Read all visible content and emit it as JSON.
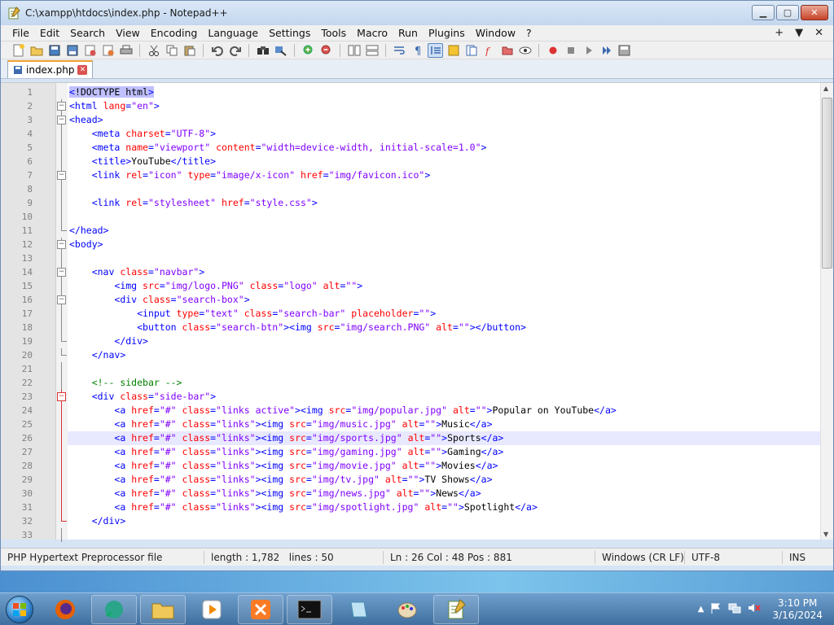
{
  "window": {
    "title": "C:\\xampp\\htdocs\\index.php - Notepad++",
    "controls": {
      "minimize": "▁",
      "maximize": "▢",
      "close": "✕"
    }
  },
  "menu": {
    "items": [
      "File",
      "Edit",
      "Search",
      "View",
      "Encoding",
      "Language",
      "Settings",
      "Tools",
      "Macro",
      "Run",
      "Plugins",
      "Window",
      "?"
    ],
    "right": [
      "+",
      "▼",
      "✕"
    ]
  },
  "tabs": [
    {
      "label": "index.php",
      "active": true
    }
  ],
  "editor": {
    "current_line": 26,
    "lines": [
      {
        "n": "1",
        "fold": "",
        "html": "<span class='t-sel'><span class='t-tag'>&lt;</span>!DOCTYPE html<span class='t-tag'>&gt;</span></span>"
      },
      {
        "n": "2",
        "fold": "box",
        "html": "<span class='t-tag'>&lt;html</span> <span class='t-attr'>lang</span><span class='t-tag'>=</span><span class='t-val'>\"en\"</span><span class='t-tag'>&gt;</span>"
      },
      {
        "n": "3",
        "fold": "box",
        "html": "<span class='t-tag'>&lt;head&gt;</span>"
      },
      {
        "n": "4",
        "fold": "bar",
        "html": "    <span class='t-tag'>&lt;meta</span> <span class='t-attr'>charset</span><span class='t-tag'>=</span><span class='t-val'>\"UTF-8\"</span><span class='t-tag'>&gt;</span>"
      },
      {
        "n": "5",
        "fold": "bar",
        "html": "    <span class='t-tag'>&lt;meta</span> <span class='t-attr'>name</span><span class='t-tag'>=</span><span class='t-val'>\"viewport\"</span> <span class='t-attr'>content</span><span class='t-tag'>=</span><span class='t-val'>\"width=device-width, initial-scale=1.0\"</span><span class='t-tag'>&gt;</span>"
      },
      {
        "n": "6",
        "fold": "bar",
        "html": "    <span class='t-tag'>&lt;title&gt;</span><span class='t-txt'>YouTube</span><span class='t-tag'>&lt;/title&gt;</span>"
      },
      {
        "n": "7",
        "fold": "box",
        "html": "    <span class='t-tag'>&lt;link</span> <span class='t-attr'>rel</span><span class='t-tag'>=</span><span class='t-val'>\"icon\"</span> <span class='t-attr'>type</span><span class='t-tag'>=</span><span class='t-val'>\"image/x-icon\"</span> <span class='t-attr'>href</span><span class='t-tag'>=</span><span class='t-val'>\"img/favicon.ico\"</span><span class='t-tag'>&gt;</span>"
      },
      {
        "n": "8",
        "fold": "bar",
        "html": ""
      },
      {
        "n": "9",
        "fold": "bar",
        "html": "    <span class='t-tag'>&lt;link</span> <span class='t-attr'>rel</span><span class='t-tag'>=</span><span class='t-val'>\"stylesheet\"</span> <span class='t-attr'>href</span><span class='t-tag'>=</span><span class='t-val'>\"style.css\"</span><span class='t-tag'>&gt;</span>"
      },
      {
        "n": "10",
        "fold": "bar",
        "html": ""
      },
      {
        "n": "11",
        "fold": "end",
        "html": "<span class='t-tag'>&lt;/head&gt;</span>"
      },
      {
        "n": "12",
        "fold": "box",
        "html": "<span class='t-tag'>&lt;body&gt;</span>"
      },
      {
        "n": "13",
        "fold": "bar",
        "html": ""
      },
      {
        "n": "14",
        "fold": "box",
        "html": "    <span class='t-tag'>&lt;nav</span> <span class='t-attr'>class</span><span class='t-tag'>=</span><span class='t-val'>\"navbar\"</span><span class='t-tag'>&gt;</span>"
      },
      {
        "n": "15",
        "fold": "bar",
        "html": "        <span class='t-tag'>&lt;img</span> <span class='t-attr'>src</span><span class='t-tag'>=</span><span class='t-val'>\"img/logo.PNG\"</span> <span class='t-attr'>class</span><span class='t-tag'>=</span><span class='t-val'>\"logo\"</span> <span class='t-attr'>alt</span><span class='t-tag'>=</span><span class='t-val'>\"\"</span><span class='t-tag'>&gt;</span>"
      },
      {
        "n": "16",
        "fold": "box",
        "html": "        <span class='t-tag'>&lt;div</span> <span class='t-attr'>class</span><span class='t-tag'>=</span><span class='t-val'>\"search-box\"</span><span class='t-tag'>&gt;</span>"
      },
      {
        "n": "17",
        "fold": "bar",
        "html": "            <span class='t-tag'>&lt;input</span> <span class='t-attr'>type</span><span class='t-tag'>=</span><span class='t-val'>\"text\"</span> <span class='t-attr'>class</span><span class='t-tag'>=</span><span class='t-val'>\"search-bar\"</span> <span class='t-attr'>placeholder</span><span class='t-tag'>=</span><span class='t-val'>\"\"</span><span class='t-tag'>&gt;</span>"
      },
      {
        "n": "18",
        "fold": "bar",
        "html": "            <span class='t-tag'>&lt;button</span> <span class='t-attr'>class</span><span class='t-tag'>=</span><span class='t-val'>\"search-btn\"</span><span class='t-tag'>&gt;&lt;img</span> <span class='t-attr'>src</span><span class='t-tag'>=</span><span class='t-val'>\"img/search.PNG\"</span> <span class='t-attr'>alt</span><span class='t-tag'>=</span><span class='t-val'>\"\"</span><span class='t-tag'>&gt;&lt;/button&gt;</span>"
      },
      {
        "n": "19",
        "fold": "end",
        "html": "        <span class='t-tag'>&lt;/div&gt;</span>"
      },
      {
        "n": "20",
        "fold": "end",
        "html": "    <span class='t-tag'>&lt;/nav&gt;</span>"
      },
      {
        "n": "21",
        "fold": "bar",
        "html": ""
      },
      {
        "n": "22",
        "fold": "bar",
        "html": "    <span class='t-com'>&lt;!-- sidebar --&gt;</span>"
      },
      {
        "n": "23",
        "fold": "boxred",
        "html": "    <span class='t-tag'>&lt;div</span> <span class='t-attr'>class</span><span class='t-tag'>=</span><span class='t-val'>\"side-bar\"</span><span class='t-tag'>&gt;</span>"
      },
      {
        "n": "24",
        "fold": "barred",
        "html": "        <span class='t-tag'>&lt;a</span> <span class='t-attr'>href</span><span class='t-tag'>=</span><span class='t-val'>\"#\"</span> <span class='t-attr'>class</span><span class='t-tag'>=</span><span class='t-val'>\"links active\"</span><span class='t-tag'>&gt;&lt;img</span> <span class='t-attr'>src</span><span class='t-tag'>=</span><span class='t-val'>\"img/popular.jpg\"</span> <span class='t-attr'>alt</span><span class='t-tag'>=</span><span class='t-val'>\"\"</span><span class='t-tag'>&gt;</span><span class='t-txt'>Popular on YouTube</span><span class='t-tag'>&lt;/a&gt;</span>"
      },
      {
        "n": "25",
        "fold": "barred",
        "html": "        <span class='t-tag'>&lt;a</span> <span class='t-attr'>href</span><span class='t-tag'>=</span><span class='t-val'>\"#\"</span> <span class='t-attr'>class</span><span class='t-tag'>=</span><span class='t-val'>\"links\"</span><span class='t-tag'>&gt;&lt;img</span> <span class='t-attr'>src</span><span class='t-tag'>=</span><span class='t-val'>\"img/music.jpg\"</span> <span class='t-attr'>alt</span><span class='t-tag'>=</span><span class='t-val'>\"\"</span><span class='t-tag'>&gt;</span><span class='t-txt'>Music</span><span class='t-tag'>&lt;/a&gt;</span>"
      },
      {
        "n": "26",
        "fold": "barred",
        "html": "        <span class='t-tag'>&lt;a</span> <span class='t-attr'>href</span><span class='t-tag'>=</span><span class='t-val'>\"#\"</span> <span class='t-attr'>class</span><span class='t-tag'>=</span><span class='t-val'>\"links\"</span><span class='t-tag'>&gt;&lt;img</span> <span class='t-attr'>src</span><span class='t-tag'>=</span><span class='t-val'>\"img/sports.jpg\"</span> <span class='t-attr'>alt</span><span class='t-tag'>=</span><span class='t-val'>\"\"</span><span class='t-tag'>&gt;</span><span class='t-txt'>Sports</span><span class='t-tag'>&lt;/a&gt;</span>"
      },
      {
        "n": "27",
        "fold": "barred",
        "html": "        <span class='t-tag'>&lt;a</span> <span class='t-attr'>href</span><span class='t-tag'>=</span><span class='t-val'>\"#\"</span> <span class='t-attr'>class</span><span class='t-tag'>=</span><span class='t-val'>\"links\"</span><span class='t-tag'>&gt;&lt;img</span> <span class='t-attr'>src</span><span class='t-tag'>=</span><span class='t-val'>\"img/gaming.jpg\"</span> <span class='t-attr'>alt</span><span class='t-tag'>=</span><span class='t-val'>\"\"</span><span class='t-tag'>&gt;</span><span class='t-txt'>Gaming</span><span class='t-tag'>&lt;/a&gt;</span>"
      },
      {
        "n": "28",
        "fold": "barred",
        "html": "        <span class='t-tag'>&lt;a</span> <span class='t-attr'>href</span><span class='t-tag'>=</span><span class='t-val'>\"#\"</span> <span class='t-attr'>class</span><span class='t-tag'>=</span><span class='t-val'>\"links\"</span><span class='t-tag'>&gt;&lt;img</span> <span class='t-attr'>src</span><span class='t-tag'>=</span><span class='t-val'>\"img/movie.jpg\"</span> <span class='t-attr'>alt</span><span class='t-tag'>=</span><span class='t-val'>\"\"</span><span class='t-tag'>&gt;</span><span class='t-txt'>Movies</span><span class='t-tag'>&lt;/a&gt;</span>"
      },
      {
        "n": "29",
        "fold": "barred",
        "html": "        <span class='t-tag'>&lt;a</span> <span class='t-attr'>href</span><span class='t-tag'>=</span><span class='t-val'>\"#\"</span> <span class='t-attr'>class</span><span class='t-tag'>=</span><span class='t-val'>\"links\"</span><span class='t-tag'>&gt;&lt;img</span> <span class='t-attr'>src</span><span class='t-tag'>=</span><span class='t-val'>\"img/tv.jpg\"</span> <span class='t-attr'>alt</span><span class='t-tag'>=</span><span class='t-val'>\"\"</span><span class='t-tag'>&gt;</span><span class='t-txt'>TV Shows</span><span class='t-tag'>&lt;/a&gt;</span>"
      },
      {
        "n": "30",
        "fold": "barred",
        "html": "        <span class='t-tag'>&lt;a</span> <span class='t-attr'>href</span><span class='t-tag'>=</span><span class='t-val'>\"#\"</span> <span class='t-attr'>class</span><span class='t-tag'>=</span><span class='t-val'>\"links\"</span><span class='t-tag'>&gt;&lt;img</span> <span class='t-attr'>src</span><span class='t-tag'>=</span><span class='t-val'>\"img/news.jpg\"</span> <span class='t-attr'>alt</span><span class='t-tag'>=</span><span class='t-val'>\"\"</span><span class='t-tag'>&gt;</span><span class='t-txt'>News</span><span class='t-tag'>&lt;/a&gt;</span>"
      },
      {
        "n": "31",
        "fold": "barred",
        "html": "        <span class='t-tag'>&lt;a</span> <span class='t-attr'>href</span><span class='t-tag'>=</span><span class='t-val'>\"#\"</span> <span class='t-attr'>class</span><span class='t-tag'>=</span><span class='t-val'>\"links\"</span><span class='t-tag'>&gt;&lt;img</span> <span class='t-attr'>src</span><span class='t-tag'>=</span><span class='t-val'>\"img/spotlight.jpg\"</span> <span class='t-attr'>alt</span><span class='t-tag'>=</span><span class='t-val'>\"\"</span><span class='t-tag'>&gt;</span><span class='t-txt'>Spotlight</span><span class='t-tag'>&lt;/a&gt;</span>"
      },
      {
        "n": "32",
        "fold": "endred",
        "html": "    <span class='t-tag'>&lt;/div&gt;</span>"
      },
      {
        "n": "33",
        "fold": "bar",
        "html": ""
      }
    ]
  },
  "status": {
    "file_type": "PHP Hypertext Preprocessor file",
    "length": "length : 1,782",
    "lines": "lines : 50",
    "position": "Ln : 26    Col : 48    Pos : 881",
    "eol": "Windows (CR LF)",
    "encoding": "UTF-8",
    "mode": "INS"
  },
  "taskbar": {
    "clock_time": "3:10 PM",
    "clock_date": "3/16/2024"
  }
}
